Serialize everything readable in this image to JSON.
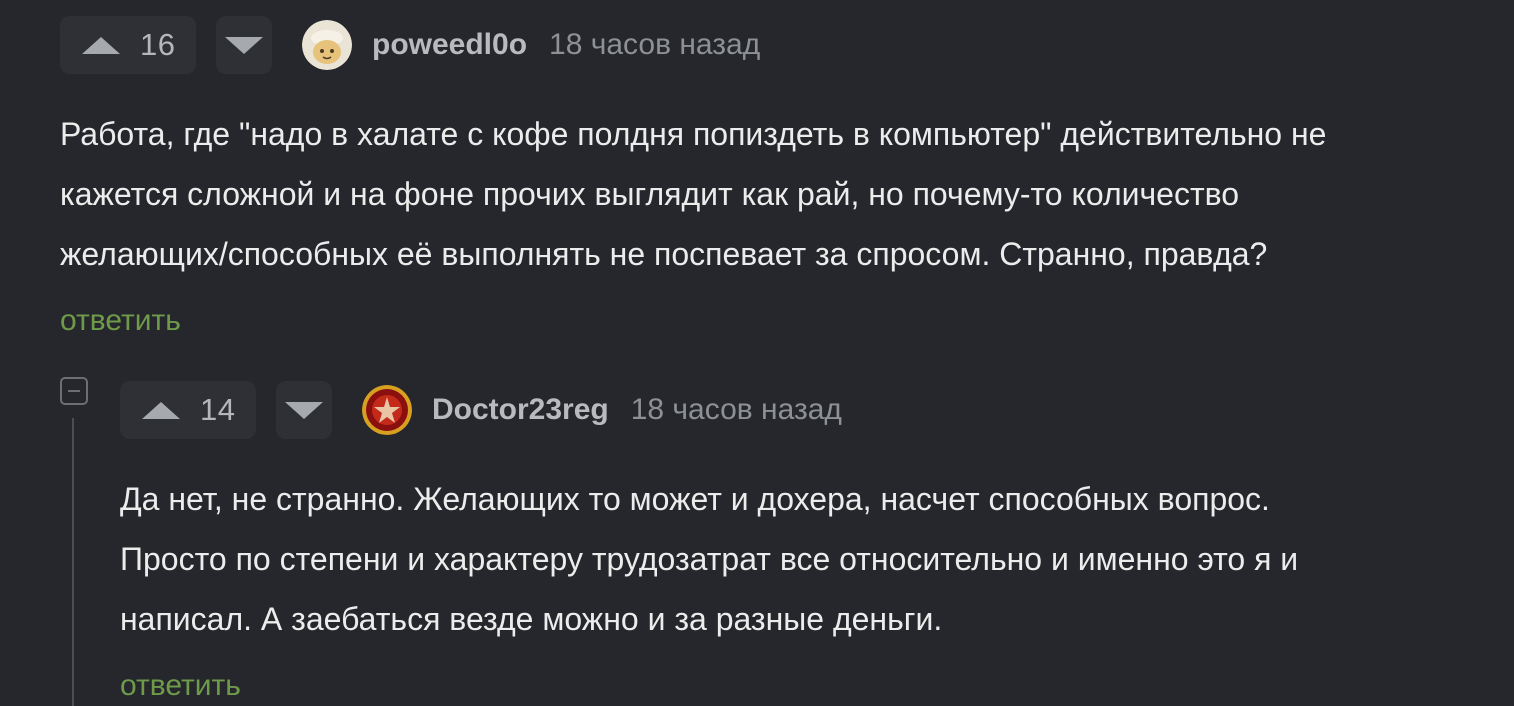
{
  "comments": [
    {
      "rating": "16",
      "username": "poweedl0o",
      "time": "18 часов назад",
      "lines": [
        "Работа, где \"надо в халате с кофе полдня попиздеть в компьютер\" действительно не",
        "кажется сложной и на фоне прочих выглядит как рай, но почему-то количество",
        "желающих/способных её выполнять не поспевает за спросом. Странно, правда?"
      ],
      "reply_label": "ответить"
    },
    {
      "rating": "14",
      "username": "Doctor23reg",
      "time": "18 часов назад",
      "lines": [
        "Да нет, не странно. Желающих то может и дохера, насчет способных вопрос.",
        "Просто по степени и характеру трудозатрат все относительно и именно это я и",
        "написал. А заебаться везде можно и за разные деньги."
      ],
      "reply_label": "ответить"
    }
  ],
  "colors": {
    "background": "#25272c",
    "reply_link": "#6e9a4a",
    "vote_box": "#2e3035"
  }
}
